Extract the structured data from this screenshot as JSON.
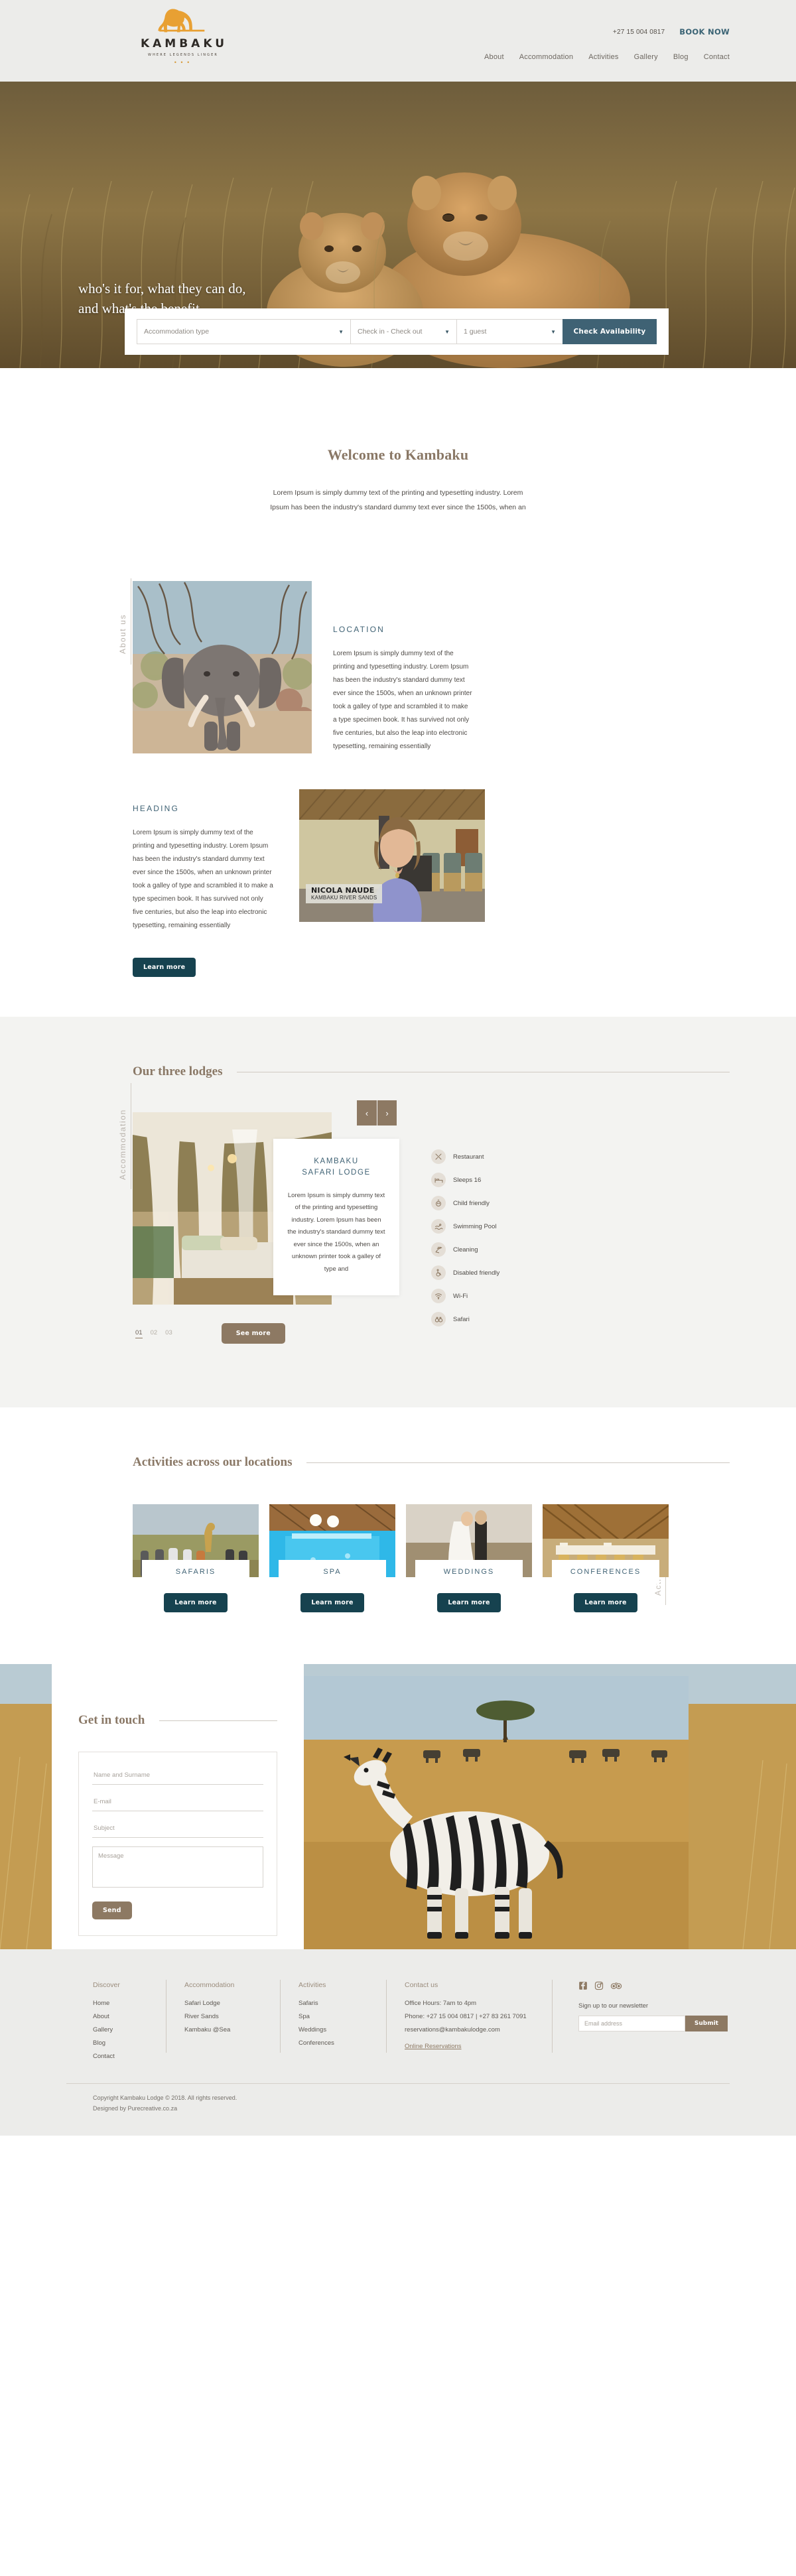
{
  "header": {
    "logo_word": "KAMBAKU",
    "logo_tagline": "WHERE LEGENDS LINGER",
    "logo_dots": "• • •",
    "phone": "+27 15 004 0817",
    "book_now": "BOOK NOW",
    "nav": [
      {
        "label": "About"
      },
      {
        "label": "Accommodation"
      },
      {
        "label": "Activities"
      },
      {
        "label": "Gallery"
      },
      {
        "label": "Blog"
      },
      {
        "label": "Contact"
      }
    ]
  },
  "hero": {
    "title_line1": "who's it for, what they can do,",
    "title_line2": "and what's the benefit.",
    "booking": {
      "accommodation_type": "Accommodation type",
      "dates": "Check in - Check out",
      "guests": "1 guest",
      "submit": "Check Availability"
    }
  },
  "welcome": {
    "title": "Welcome to Kambaku",
    "body": "Lorem Ipsum is simply dummy text of the printing and typesetting industry. Lorem Ipsum has been the industry's standard dummy text ever since the 1500s, when an"
  },
  "about": {
    "side_label": "About us",
    "location": {
      "eyebrow": "LOCATION",
      "body": "Lorem Ipsum is simply dummy text of the printing and typesetting industry. Lorem Ipsum has been the industry's standard dummy text ever since the 1500s, when an unknown printer took a galley of type and scrambled it to make a type specimen book. It has survived not only five centuries, but also the leap into electronic typesetting, remaining essentially"
    },
    "heading": {
      "eyebrow": "HEADING",
      "body": "Lorem Ipsum is simply dummy text of the printing and typesetting industry. Lorem Ipsum has been the industry's standard dummy text ever since the 1500s, when an unknown printer took a galley of type and scrambled it to make a type specimen book. It has survived not only five centuries, but also the leap into electronic typesetting, remaining essentially",
      "button": "Learn more"
    },
    "video_caption_name": "NICOLA NAUDE",
    "video_caption_sub": "KAMBAKU RIVER SANDS"
  },
  "lodges": {
    "side_label": "Accommodation",
    "title": "Our three lodges",
    "prev": "‹",
    "next": "›",
    "card": {
      "title_line1": "KAMBAKU",
      "title_line2": "SAFARI LODGE",
      "body": "Lorem Ipsum is simply dummy text of the printing and typesetting industry. Lorem Ipsum has been the industry's standard dummy text ever since the 1500s, when an unknown printer took a galley of type and"
    },
    "amenities": [
      {
        "icon": "restaurant-icon",
        "label": "Restaurant"
      },
      {
        "icon": "bed-icon",
        "label": "Sleeps 16"
      },
      {
        "icon": "child-icon",
        "label": "Child friendly"
      },
      {
        "icon": "swimmer-icon",
        "label": "Swimming Pool"
      },
      {
        "icon": "cleaning-icon",
        "label": "Cleaning"
      },
      {
        "icon": "wheelchair-icon",
        "label": "Disabled friendly"
      },
      {
        "icon": "wifi-icon",
        "label": "Wi-Fi"
      },
      {
        "icon": "binoculars-icon",
        "label": "Safari"
      }
    ],
    "pager": [
      "01",
      "02",
      "03"
    ],
    "see_more": "See more"
  },
  "activities": {
    "side_label": "Activities",
    "title": "Activities across our locations",
    "cards": [
      {
        "name": "SAFARIS",
        "button": "Learn more"
      },
      {
        "name": "SPA",
        "button": "Learn more"
      },
      {
        "name": "WEDDINGS",
        "button": "Learn more"
      },
      {
        "name": "CONFERENCES",
        "button": "Learn more"
      }
    ]
  },
  "contact": {
    "title": "Get in touch",
    "name_placeholder": "Name and Surname",
    "email_placeholder": "E-mail",
    "subject_placeholder": "Subject",
    "message_placeholder": "Message",
    "send": "Send"
  },
  "footer": {
    "col_discover": {
      "heading": "Discover",
      "links": [
        "Home",
        "About",
        "Gallery",
        "Blog",
        "Contact"
      ]
    },
    "col_accommodation": {
      "heading": "Accommodation",
      "links": [
        "Safari Lodge",
        "River Sands",
        "Kambaku @Sea"
      ]
    },
    "col_activities": {
      "heading": "Activities",
      "links": [
        "Safaris",
        "Spa",
        "Weddings",
        "Conferences"
      ]
    },
    "col_contact": {
      "heading": "Contact us",
      "office_hours": "Office Hours: 7am to 4pm",
      "phone": "Phone: +27 15 004 0817  |  +27 83 261 7091",
      "email": "reservations@kambakulodge.com",
      "online_reservations": "Online Reservations"
    },
    "newsletter": {
      "label": "Sign up to our newsletter",
      "placeholder": "Email address",
      "submit": "Submit"
    },
    "socials": [
      {
        "icon": "facebook-icon"
      },
      {
        "icon": "instagram-icon"
      },
      {
        "icon": "tripadvisor-icon"
      }
    ],
    "copyright": "Copyright Kambaku Lodge © 2018. All rights reserved.",
    "designed_by": "Designed by Purecreative.co.za"
  },
  "colors": {
    "brand_orange": "#e8a033",
    "teal": "#3f6274",
    "dark_teal": "#16424f",
    "brown": "#8d7963",
    "serif_brown": "#8a7866",
    "header_bg": "#ececea"
  }
}
